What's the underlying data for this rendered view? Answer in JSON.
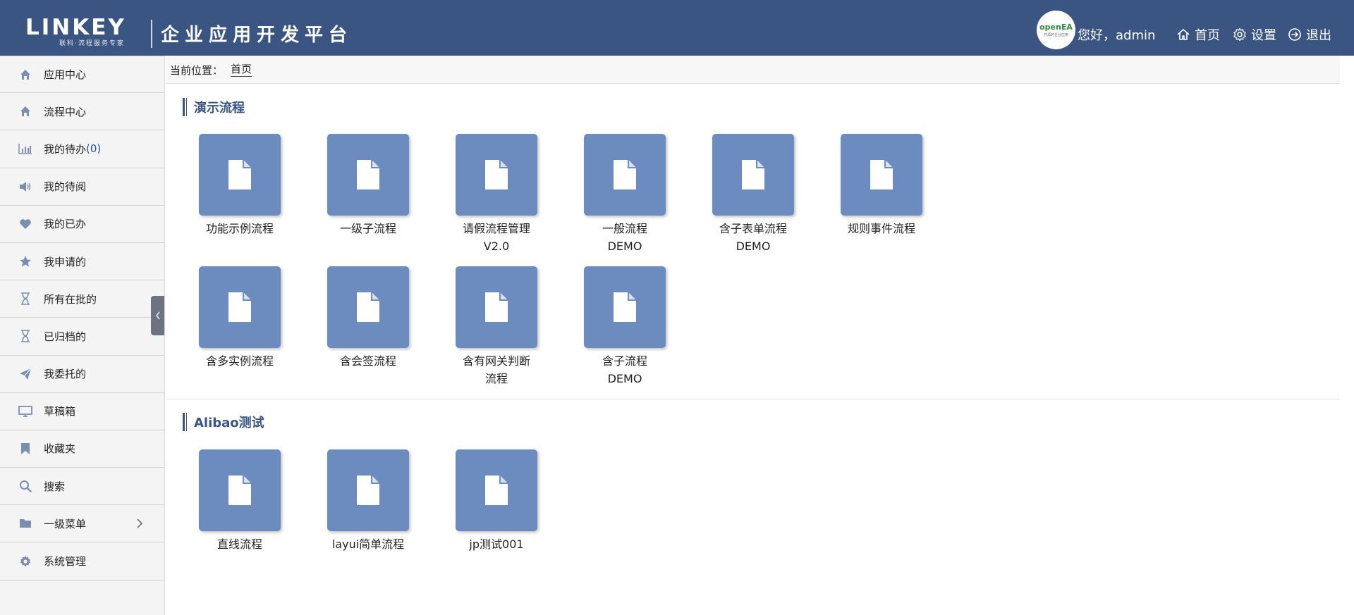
{
  "header": {
    "logo_main": "LINKEY",
    "logo_sub": "联科·流程服务专家",
    "app_title": "企业应用开发平台",
    "avatar_text": "openEA",
    "avatar_sub": "开源的企业应用",
    "greeting": "您好，admin",
    "home_label": "首页",
    "settings_label": "设置",
    "logout_label": "退出"
  },
  "sidebar": {
    "items": [
      {
        "label": "应用中心",
        "icon": "home-icon"
      },
      {
        "label": "流程中心",
        "icon": "home-icon"
      },
      {
        "label": "我的待办",
        "count": "(0)",
        "icon": "bar-chart-icon"
      },
      {
        "label": "我的待阅",
        "icon": "speaker-icon"
      },
      {
        "label": "我的已办",
        "icon": "heart-icon"
      },
      {
        "label": "我申请的",
        "icon": "star-icon"
      },
      {
        "label": "所有在批的",
        "icon": "hourglass-icon"
      },
      {
        "label": "已归档的",
        "icon": "hourglass-icon"
      },
      {
        "label": "我委托的",
        "icon": "send-icon"
      },
      {
        "label": "草稿箱",
        "icon": "monitor-icon"
      },
      {
        "label": "收藏夹",
        "icon": "bookmark-icon"
      },
      {
        "label": "搜索",
        "icon": "search-icon"
      },
      {
        "label": "一级菜单",
        "icon": "folder-icon",
        "has_children": true
      },
      {
        "label": "系统管理",
        "icon": "gear-icon"
      }
    ]
  },
  "breadcrumb": {
    "label": "当前位置：",
    "current": "首页"
  },
  "sections": [
    {
      "title": "演示流程",
      "tiles": [
        {
          "label": "功能示例流程"
        },
        {
          "label": "一级子流程"
        },
        {
          "label": "请假流程管理V2.0"
        },
        {
          "label": "一般流程DEMO"
        },
        {
          "label": "含子表单流程DEMO"
        },
        {
          "label": "规则事件流程"
        },
        {
          "label": "含多实例流程"
        },
        {
          "label": "含会签流程"
        },
        {
          "label": "含有网关判断流程"
        },
        {
          "label": "含子流程DEMO"
        }
      ]
    },
    {
      "title": "Alibao测试",
      "tiles": [
        {
          "label": "直线流程"
        },
        {
          "label": "layui简单流程"
        },
        {
          "label": "jp测试001"
        }
      ]
    }
  ],
  "colors": {
    "header_bg": "#3a5582",
    "tile_bg": "#6c8cbf",
    "section_accent": "#3a5582"
  }
}
